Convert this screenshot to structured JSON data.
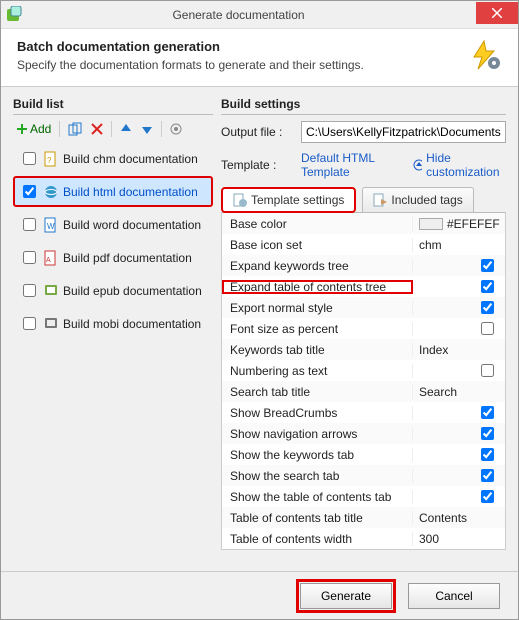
{
  "window": {
    "title": "Generate documentation"
  },
  "header": {
    "title": "Batch documentation generation",
    "subtitle": "Specify the documentation formats to generate and their settings."
  },
  "buildList": {
    "title": "Build list",
    "addLabel": "Add",
    "items": [
      {
        "label": "Build chm documentation",
        "checked": false
      },
      {
        "label": "Build html documentation",
        "checked": true
      },
      {
        "label": "Build word documentation",
        "checked": false
      },
      {
        "label": "Build pdf documentation",
        "checked": false
      },
      {
        "label": "Build epub documentation",
        "checked": false
      },
      {
        "label": "Build mobi documentation",
        "checked": false
      }
    ]
  },
  "buildSettings": {
    "title": "Build settings",
    "outputLabel": "Output file :",
    "outputValue": "C:\\Users\\KellyFitzpatrick\\Documents\\HelpNDo…",
    "templateLabel": "Template :",
    "templateValue": "Default HTML Template",
    "hideLabel": "Hide customization",
    "tabs": {
      "templateSettings": "Template settings",
      "includedTags": "Included tags"
    },
    "rows": [
      {
        "label": "Base color",
        "value": "#EFEFEF",
        "kind": "color"
      },
      {
        "label": "Base icon set",
        "value": "chm",
        "kind": "text"
      },
      {
        "label": "Expand keywords tree",
        "value": true,
        "kind": "check"
      },
      {
        "label": "Expand table of contents tree",
        "value": true,
        "kind": "check",
        "highlight": true
      },
      {
        "label": "Export normal style",
        "value": true,
        "kind": "check"
      },
      {
        "label": "Font size as percent",
        "value": false,
        "kind": "check"
      },
      {
        "label": "Keywords tab title",
        "value": "Index",
        "kind": "text"
      },
      {
        "label": "Numbering as text",
        "value": false,
        "kind": "check"
      },
      {
        "label": "Search tab title",
        "value": "Search",
        "kind": "text"
      },
      {
        "label": "Show BreadCrumbs",
        "value": true,
        "kind": "check"
      },
      {
        "label": "Show navigation arrows",
        "value": true,
        "kind": "check"
      },
      {
        "label": "Show the keywords tab",
        "value": true,
        "kind": "check"
      },
      {
        "label": "Show the search tab",
        "value": true,
        "kind": "check"
      },
      {
        "label": "Show the table of contents tab",
        "value": true,
        "kind": "check"
      },
      {
        "label": "Table of contents tab title",
        "value": "Contents",
        "kind": "text"
      },
      {
        "label": "Table of contents width",
        "value": "300",
        "kind": "text"
      }
    ]
  },
  "footer": {
    "generate": "Generate",
    "cancel": "Cancel"
  }
}
